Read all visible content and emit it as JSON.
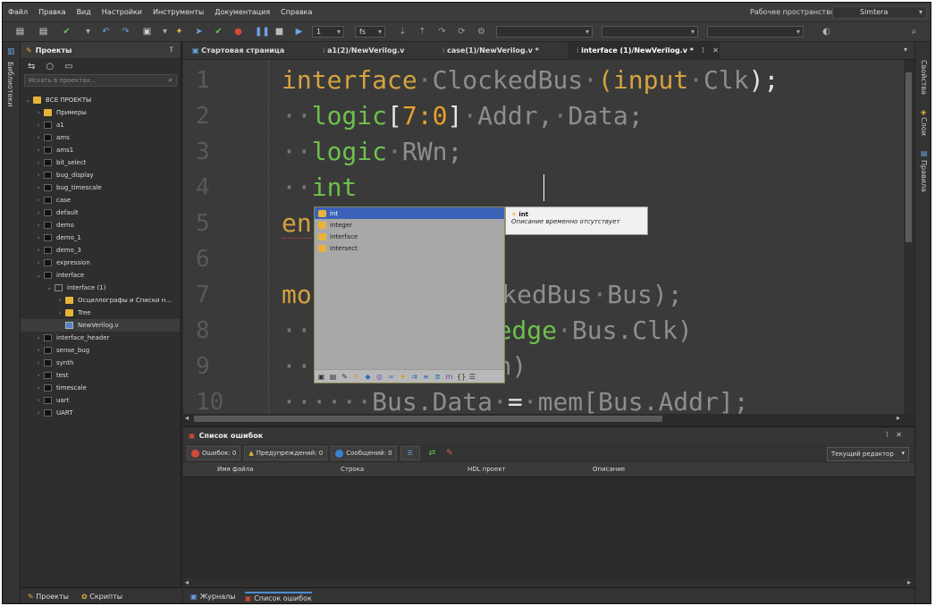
{
  "menubar": {
    "items": [
      "Файл",
      "Правка",
      "Вид",
      "Настройки",
      "Инструменты",
      "Документация",
      "Справка"
    ],
    "workspace_label": "Рабочее пространство",
    "workspace_value": "Simtera"
  },
  "toolbar": {
    "counter_value": "1",
    "time_unit": "fs"
  },
  "left_strip": {
    "library_label": "Библиотеки"
  },
  "right_strip": {
    "properties_label": "Свойства",
    "layers_label": "Слои",
    "rules_label": "Правила"
  },
  "projects": {
    "title": "Проекты",
    "search_placeholder": "Искать в проектах...",
    "tree": [
      {
        "label": "ВСЕ ПРОЕКТЫ",
        "level": 0,
        "icon": "folder-icon",
        "expanded": true
      },
      {
        "label": "Примеры",
        "level": 1,
        "icon": "folder-icon"
      },
      {
        "label": "a1",
        "level": 1,
        "icon": "project-icon"
      },
      {
        "label": "ams",
        "level": 1,
        "icon": "project-icon"
      },
      {
        "label": "ams1",
        "level": 1,
        "icon": "project-icon"
      },
      {
        "label": "bit_select",
        "level": 1,
        "icon": "project-icon"
      },
      {
        "label": "bug_display",
        "level": 1,
        "icon": "project-icon"
      },
      {
        "label": "bug_timescale",
        "level": 1,
        "icon": "project-icon"
      },
      {
        "label": "case",
        "level": 1,
        "icon": "project-icon"
      },
      {
        "label": "default",
        "level": 1,
        "icon": "project-icon"
      },
      {
        "label": "demo",
        "level": 1,
        "icon": "project-icon"
      },
      {
        "label": "demo_1",
        "level": 1,
        "icon": "project-icon"
      },
      {
        "label": "demo_3",
        "level": 1,
        "icon": "project-icon"
      },
      {
        "label": "expression",
        "level": 1,
        "icon": "project-icon"
      },
      {
        "label": "interface",
        "level": 1,
        "icon": "project-icon",
        "expanded": true
      },
      {
        "label": "interface (1)",
        "level": 2,
        "icon": "subproject-icon",
        "expanded": true
      },
      {
        "label": "Осциллографы и Списки н...",
        "level": 3,
        "icon": "folder-icon"
      },
      {
        "label": "Tree",
        "level": 3,
        "icon": "folder-icon"
      },
      {
        "label": "NewVerilog.v",
        "level": 3,
        "icon": "verilog-file-icon",
        "selected": true
      },
      {
        "label": "interface_header",
        "level": 1,
        "icon": "project-icon"
      },
      {
        "label": "sense_bug",
        "level": 1,
        "icon": "project-icon"
      },
      {
        "label": "synth",
        "level": 1,
        "icon": "project-icon"
      },
      {
        "label": "test",
        "level": 1,
        "icon": "project-icon"
      },
      {
        "label": "timescale",
        "level": 1,
        "icon": "project-icon"
      },
      {
        "label": "uart",
        "level": 1,
        "icon": "project-icon"
      },
      {
        "label": "UART",
        "level": 1,
        "icon": "project-icon"
      }
    ],
    "bottom_tabs": [
      "Проекты",
      "Скрипты"
    ]
  },
  "editor": {
    "tabs": [
      {
        "label": "Стартовая страница"
      },
      {
        "label": "a1(2)/NewVerilog.v"
      },
      {
        "label": "case(1)/NewVerilog.v *"
      },
      {
        "label": "interface (1)/NewVerilog.v *",
        "active": true
      }
    ],
    "line_numbers": [
      "1",
      "2",
      "3",
      "4",
      "5",
      "6",
      "7",
      "8",
      "9",
      "10"
    ],
    "code": {
      "l1_kw": "interface",
      "l1_name": "ClockedBus",
      "l1_paren": "(",
      "l1_input": "input",
      "l1_clk": "Clk",
      "l1_end": ");",
      "l2_logic": "logic",
      "l2_range_open": "[",
      "l2_range": "7:0",
      "l2_range_close": "]",
      "l2_addr": "Addr,",
      "l2_data": "Data;",
      "l3_logic": "logic",
      "l3_rwn": "RWn;",
      "l4_int": "int",
      "l5_kw": "en",
      "l7_kw": "mo",
      "l7_rest": "lockedBus",
      "l7_bus": "Bus);",
      "l8_kw": "sedge",
      "l8_rest": "Bus.Clk)",
      "l9_rest": "Wn)",
      "l10_bus": "Bus.Data",
      "l10_eq": "=",
      "l10_mem": "mem[Bus.Addr];"
    }
  },
  "autocomplete": {
    "items": [
      "int",
      "integer",
      "interface",
      "intersect"
    ],
    "tooltip_title": "int",
    "tooltip_desc": "Описание временно отсутствует"
  },
  "errors_panel": {
    "title": "Список ошибок",
    "filters": {
      "errors": "Ошибок: 0",
      "warnings": "Предупреждений: 0",
      "messages": "Сообщений: 0"
    },
    "scope": "Текущий редактор",
    "columns": [
      "Имя файла",
      "Строка",
      "HDL проект",
      "Описание"
    ]
  },
  "bottom_tabs": [
    "Журналы",
    "Список ошибок"
  ],
  "colors": {
    "keyword": "#d4a340",
    "type": "#6ec04c",
    "number": "#e8a028",
    "selection": "#3b62b8"
  }
}
